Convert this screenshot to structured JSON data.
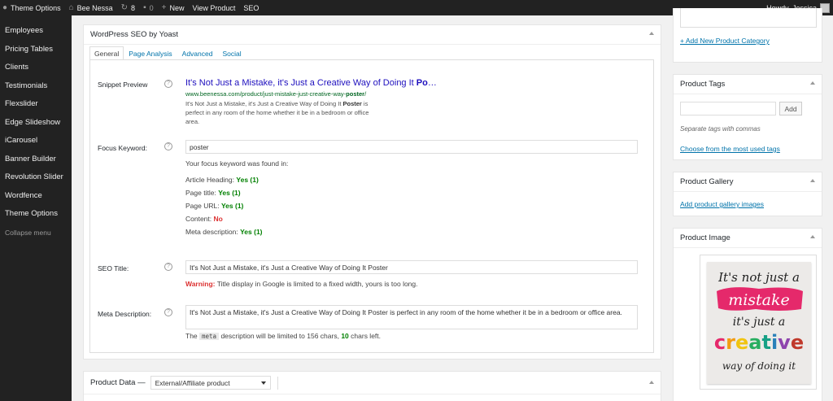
{
  "adminbar": {
    "items": [
      {
        "icon": "wp-logo-icon",
        "label": "Theme Options"
      },
      {
        "icon": "home-icon",
        "label": "Bee Nessa"
      },
      {
        "icon": "updates-icon",
        "label": "8"
      },
      {
        "icon": "comments-icon",
        "label": "0"
      },
      {
        "icon": "plus-icon",
        "label": "New"
      },
      {
        "icon": "",
        "label": "View Product"
      },
      {
        "icon": "",
        "label": "SEO"
      }
    ],
    "howdy": "Howdy, Jessica"
  },
  "sidebar": {
    "items": [
      "Employees",
      "Pricing Tables",
      "Clients",
      "Testimonials",
      "Flexslider",
      "Edge Slideshow",
      "iCarousel",
      "Banner Builder",
      "Revolution Slider",
      "Wordfence",
      "Theme Options"
    ],
    "collapse": "Collapse menu"
  },
  "seo": {
    "title": "WordPress SEO by Yoast",
    "tabs": [
      "General",
      "Page Analysis",
      "Advanced",
      "Social"
    ],
    "snippet_label": "Snippet Preview",
    "snippet_title": "It's Not Just a Mistake, it's Just a Creative Way of Doing It Po…",
    "snippet_title_bold": "Po",
    "snippet_url_pre": "www.beenessa.com/product/just-mistake-just-creative-way-",
    "snippet_url_bold": "poster",
    "snippet_url_post": "/",
    "snippet_desc_pre": "It's Not Just a Mistake, it's Just a Creative Way of Doing It ",
    "snippet_desc_bold": "Poster",
    "snippet_desc_post": " is perfect in any room of the home whether it be in a bedroom or office area.",
    "focus_label": "Focus Keyword:",
    "focus_value": "poster",
    "found_in": "Your focus keyword was found in:",
    "checks": [
      {
        "label": "Article Heading:",
        "value": "Yes (1)",
        "status": "yes"
      },
      {
        "label": "Page title:",
        "value": "Yes (1)",
        "status": "yes"
      },
      {
        "label": "Page URL:",
        "value": "Yes (1)",
        "status": "yes"
      },
      {
        "label": "Content:",
        "value": "No",
        "status": "no"
      },
      {
        "label": "Meta description:",
        "value": "Yes (1)",
        "status": "yes"
      }
    ],
    "seo_title_label": "SEO Title:",
    "seo_title_value": "It's Not Just a Mistake, it's Just a Creative Way of Doing It Poster",
    "warning_label": "Warning:",
    "warning_text": " Title display in Google is limited to a fixed width, yours is too long.",
    "meta_label": "Meta Description:",
    "meta_value": "It's Not Just a Mistake, it's Just a Creative Way of Doing It Poster is perfect in any room of the home whether it be in a bedroom or office area.",
    "meta_note_pre": "The ",
    "meta_note_code": "meta",
    "meta_note_mid": " description will be limited to 156 chars, ",
    "meta_note_count": "10",
    "meta_note_post": " chars left."
  },
  "product_data": {
    "title": "Product Data —",
    "type_selected": "External/Affiliate product"
  },
  "right": {
    "add_category": "+ Add New Product Category",
    "tags_title": "Product Tags",
    "add_button": "Add",
    "tags_hint": "Separate tags with commas",
    "tags_link": "Choose from the most used tags",
    "gallery_title": "Product Gallery",
    "gallery_link": "Add product gallery images",
    "image_title": "Product Image"
  },
  "colors": {
    "adminbar": "#222222",
    "link": "#0073aa",
    "yes": "#008000",
    "no": "#dc3232"
  }
}
